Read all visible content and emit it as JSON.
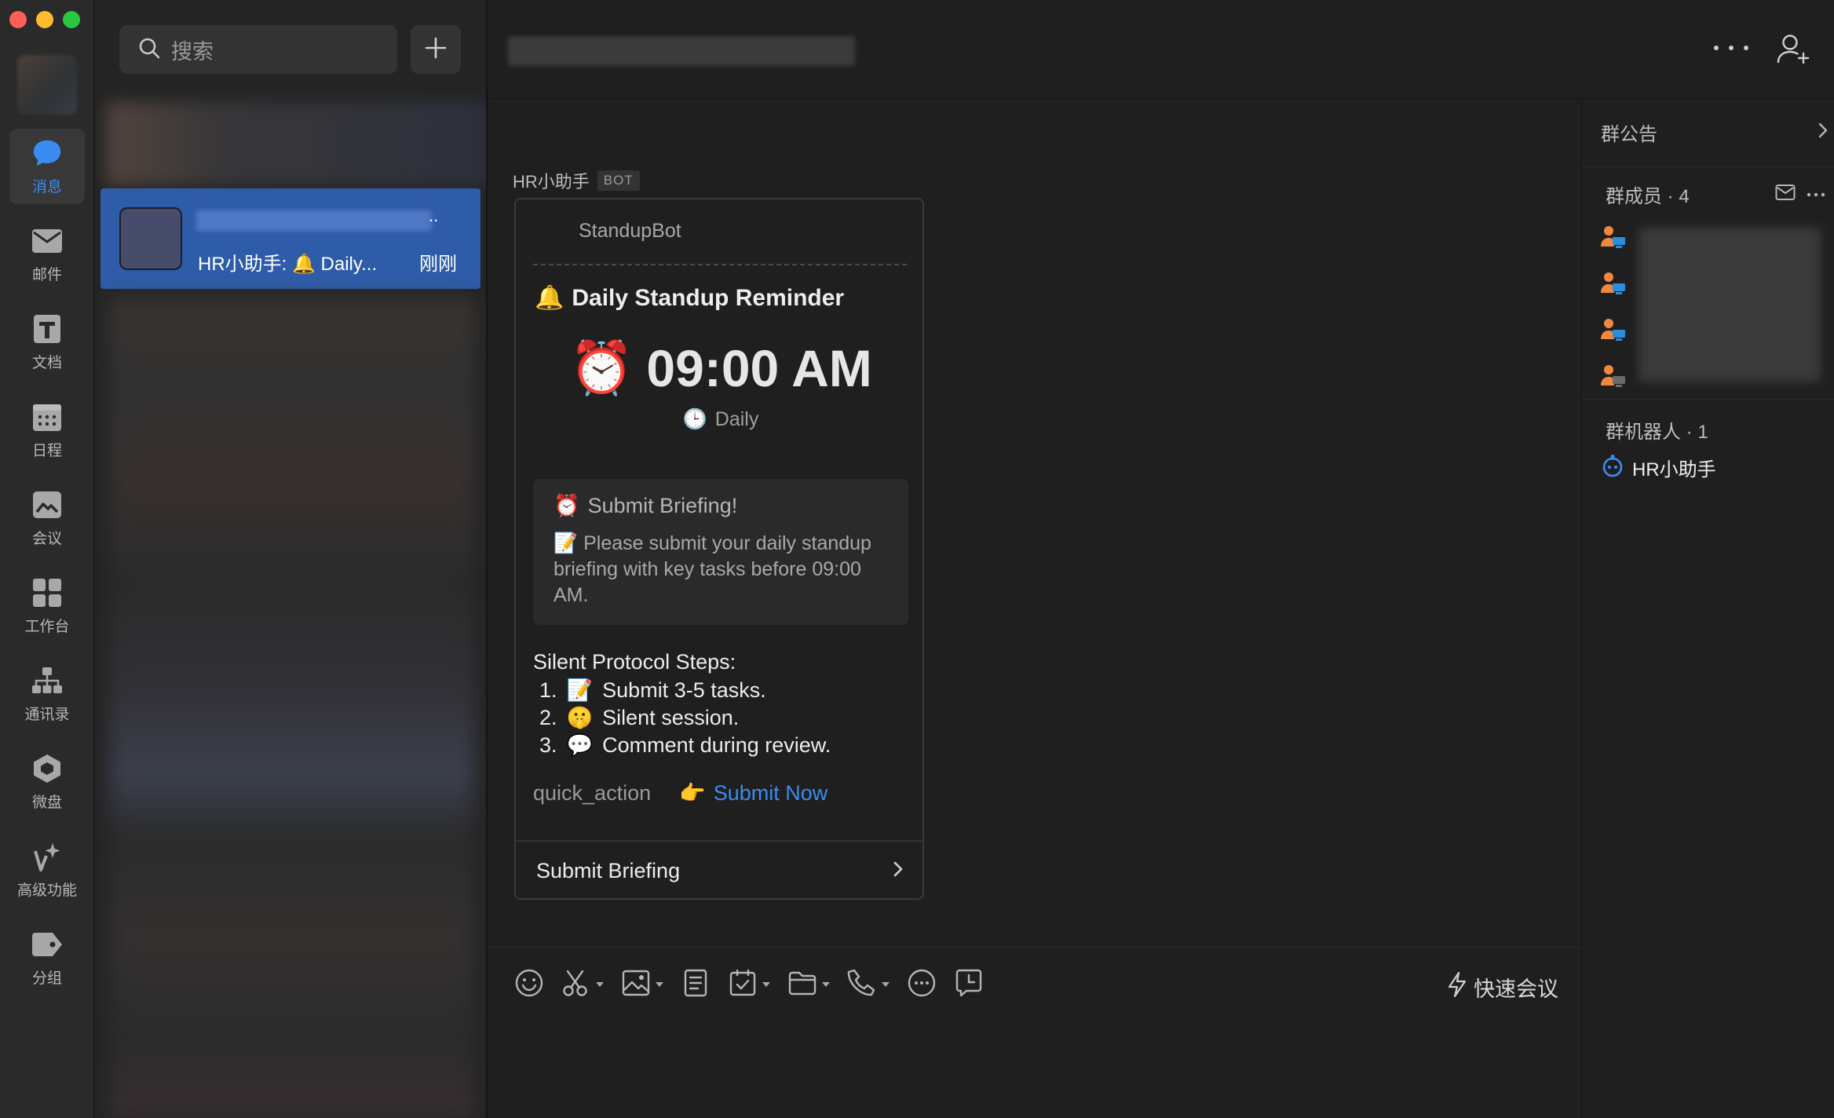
{
  "window": {
    "traffic_lights": [
      "close",
      "minimize",
      "zoom"
    ]
  },
  "rail": {
    "items": [
      {
        "label": "消息",
        "icon": "chat-bubble-icon",
        "active": true
      },
      {
        "label": "邮件",
        "icon": "mail-icon",
        "active": false
      },
      {
        "label": "文档",
        "icon": "document-icon",
        "active": false
      },
      {
        "label": "日程",
        "icon": "calendar-icon",
        "active": false
      },
      {
        "label": "会议",
        "icon": "meeting-icon",
        "active": false
      },
      {
        "label": "工作台",
        "icon": "workbench-grid-icon",
        "active": false
      },
      {
        "label": "通讯录",
        "icon": "org-chart-icon",
        "active": false
      },
      {
        "label": "微盘",
        "icon": "drive-icon",
        "active": false
      },
      {
        "label": "高级功能",
        "icon": "sparkle-icon",
        "active": false
      },
      {
        "label": "分组",
        "icon": "tag-icon",
        "active": false
      }
    ]
  },
  "list": {
    "search": {
      "placeholder": "搜索"
    },
    "active_conversation": {
      "name_truncation": "..",
      "preview": "HR小助手: 🔔 Daily...",
      "time": "刚刚"
    }
  },
  "chat": {
    "sender_name": "HR小助手",
    "sender_badge": "BOT",
    "card": {
      "header": "StandupBot",
      "title_emoji": "🔔",
      "title": "Daily Standup Reminder",
      "time_emoji": "⏰",
      "time": "09:00 AM",
      "frequency_emoji": "🕒",
      "frequency": "Daily",
      "submit_box": {
        "title_emoji": "⏰",
        "title": "Submit Briefing!",
        "body_emoji": "📝",
        "body": "Please submit your daily standup briefing with key tasks before 09:00 AM."
      },
      "steps_title": "Silent Protocol Steps:",
      "steps": [
        {
          "num": "1.",
          "emoji": "📝",
          "text": "Submit 3-5 tasks."
        },
        {
          "num": "2.",
          "emoji": "🤫",
          "text": "Silent session."
        },
        {
          "num": "3.",
          "emoji": "💬",
          "text": "Comment during review."
        }
      ],
      "quick_action_key": "quick_action",
      "quick_action_emoji": "👉",
      "quick_action_link": "Submit Now",
      "footer_button": "Submit Briefing"
    }
  },
  "toolbar": {
    "items": [
      {
        "icon": "emoji-icon",
        "dropdown": false
      },
      {
        "icon": "scissors-icon",
        "dropdown": true
      },
      {
        "icon": "image-icon",
        "dropdown": true
      },
      {
        "icon": "note-icon",
        "dropdown": false
      },
      {
        "icon": "task-check-icon",
        "dropdown": true
      },
      {
        "icon": "folder-icon",
        "dropdown": true
      },
      {
        "icon": "phone-icon",
        "dropdown": true
      },
      {
        "icon": "more-circle-icon",
        "dropdown": false
      },
      {
        "icon": "screen-share-icon",
        "dropdown": false
      }
    ],
    "quick_meeting": "快速会议"
  },
  "right_panel": {
    "notice": "群公告",
    "members_title": "群成员 · 4",
    "members_count": 4,
    "bots_title": "群机器人 · 1",
    "bot_name": "HR小助手"
  },
  "colors": {
    "accent": "#3b8cf0",
    "selected_conversation": "#2f5ca8",
    "background": "#1f1f1f",
    "rail": "#2a2a2a"
  }
}
